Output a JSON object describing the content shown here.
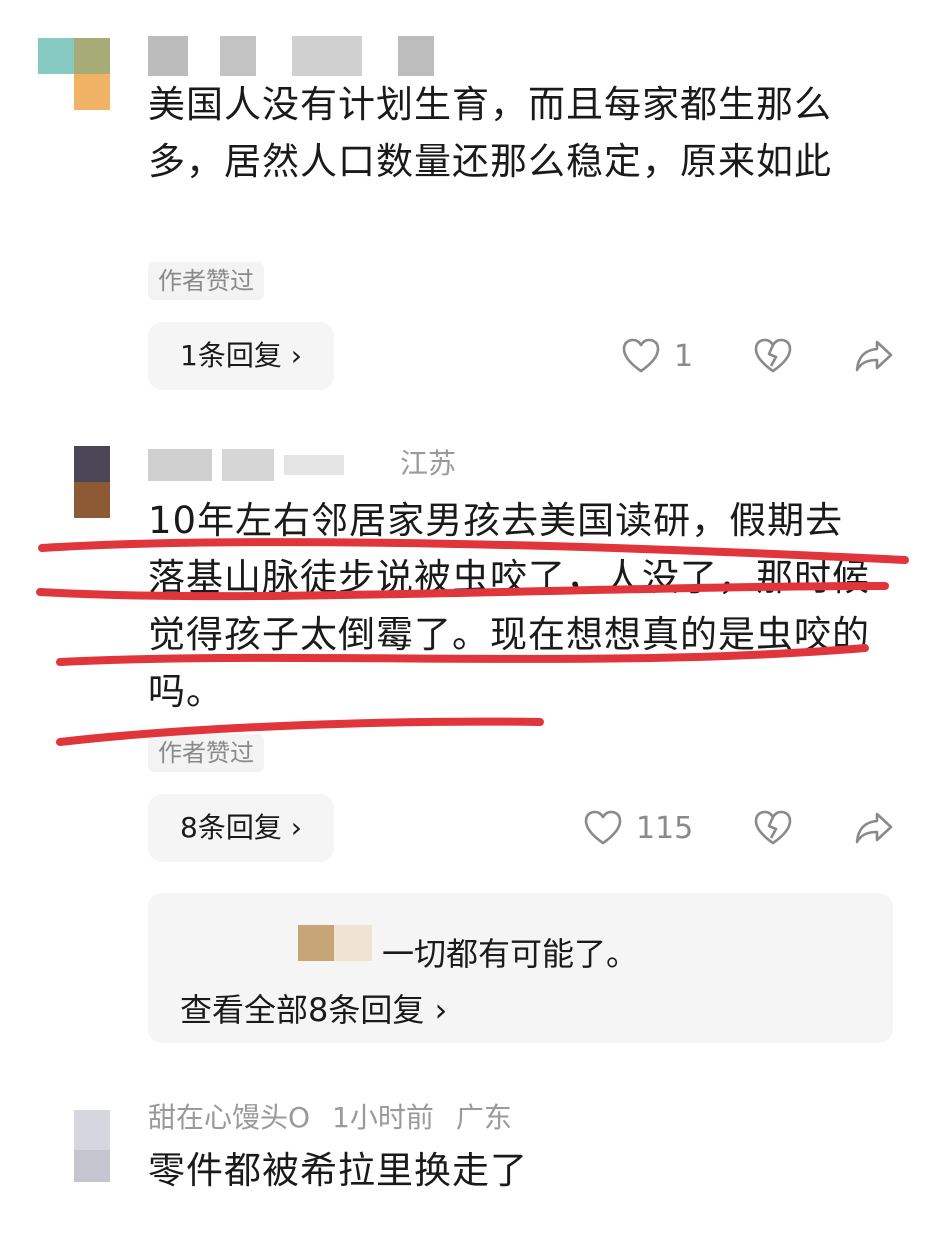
{
  "comments": [
    {
      "text": "美国人没有计划生育，而且每家都生那么多，居然人口数量还那么稳定，原来如此",
      "author_liked": "作者赞过",
      "reply_button": "1条回复 ›",
      "like_count": "1"
    },
    {
      "location": "江苏",
      "text": "10年左右邻居家男孩去美国读研，假期去落基山脉徒步说被虫咬了，人没了，那时候觉得孩子太倒霉了。现在想想真的是虫咬的吗。",
      "author_liked": "作者赞过",
      "reply_button": "8条回复 ›",
      "like_count": "115",
      "reply_preview": {
        "text": "一切都有可能了。",
        "view_all": "查看全部8条回复 ›"
      }
    },
    {
      "username": "甜在心馒头O",
      "time": "1小时前",
      "location": "广东",
      "text": "零件都被希拉里换走了"
    }
  ],
  "colors": {
    "underline_red": "#e0353a",
    "meta_gray": "#9a9a9a"
  },
  "icons": [
    "heart-icon",
    "broken-heart-icon",
    "share-icon",
    "chevron-right-icon"
  ]
}
